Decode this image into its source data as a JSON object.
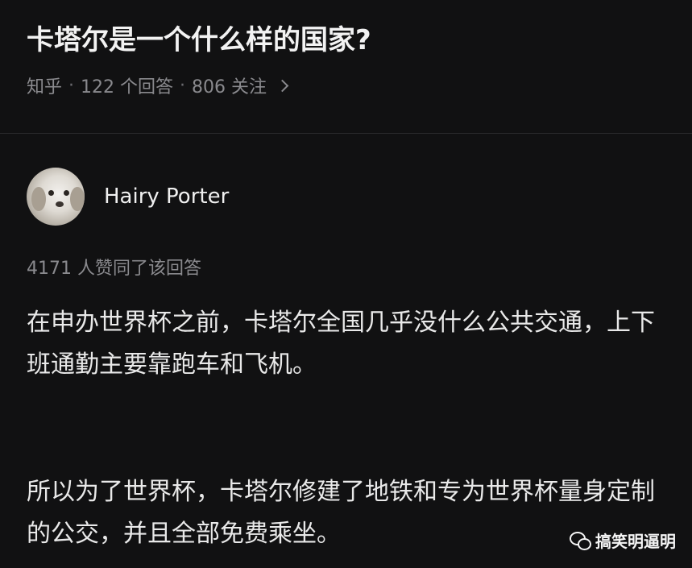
{
  "question": {
    "title": "卡塔尔是一个什么样的国家?",
    "source": "知乎",
    "answers": "122 个回答",
    "followers": "806 关注",
    "separator": "·"
  },
  "answer": {
    "author_name": "Hairy Porter",
    "vote_line": "4171 人赞同了该回答",
    "paragraphs": [
      "在申办世界杯之前，卡塔尔全国几乎没什么公共交通，上下班通勤主要靠跑车和飞机。",
      "所以为了世界杯，卡塔尔修建了地铁和专为世界杯量身定制的公交，并且全部免费乘坐。"
    ]
  },
  "watermark": {
    "icon": "wechat-icon",
    "text": "搞笑明逼明"
  }
}
